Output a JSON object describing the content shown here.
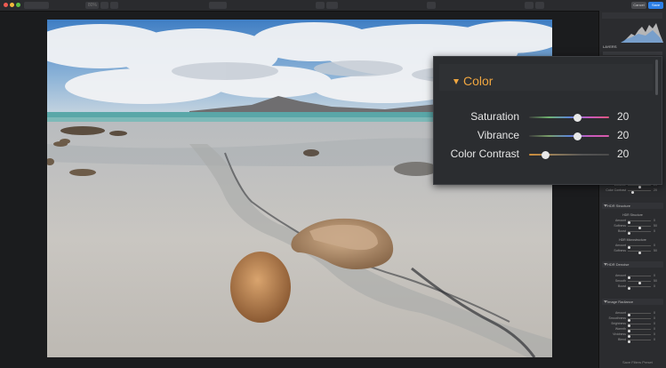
{
  "toolbar": {
    "zoom": "80%",
    "cancel_label": "Cancel",
    "save_label": "Save"
  },
  "side_panel": {
    "layers_label": "LAYERS",
    "visible_items": [
      {
        "label": "Vibrance",
        "value": "20"
      },
      {
        "label": "Color Contrast",
        "value": "20"
      }
    ],
    "sections": [
      {
        "title": "HDR Structure",
        "groups": [
          {
            "title": "HDR Structure",
            "rows": [
              {
                "label": "Amount",
                "value": "0"
              },
              {
                "label": "Softness",
                "value": "50"
              },
              {
                "label": "Boost",
                "value": "0"
              }
            ]
          },
          {
            "title": "HDR Microstructure",
            "rows": [
              {
                "label": "Amount",
                "value": "0"
              },
              {
                "label": "Softness",
                "value": "50"
              }
            ]
          }
        ]
      },
      {
        "title": "HDR Denoise",
        "groups": [
          {
            "title": "",
            "rows": [
              {
                "label": "Amount",
                "value": "0"
              },
              {
                "label": "Smooth",
                "value": "50"
              },
              {
                "label": "Boost",
                "value": "0"
              }
            ]
          }
        ]
      },
      {
        "title": "Image Radiance",
        "groups": [
          {
            "title": "",
            "rows": [
              {
                "label": "Amount",
                "value": "0"
              },
              {
                "label": "Smoothness",
                "value": "0"
              },
              {
                "label": "Brightness",
                "value": "0"
              },
              {
                "label": "Warmth",
                "value": "0"
              },
              {
                "label": "Vividness",
                "value": "0"
              },
              {
                "label": "Blend",
                "value": "0"
              }
            ]
          }
        ]
      }
    ],
    "footer_label": "Save Filters Preset"
  },
  "color_panel": {
    "title": "Color",
    "sliders": [
      {
        "label": "Saturation",
        "value": "20",
        "fraction": 0.6,
        "gradient": "linear-gradient(90deg,#3a3a3a,#6fb36f,#5d86d6,#c85bc0,#e0567e)"
      },
      {
        "label": "Vibrance",
        "value": "20",
        "fraction": 0.6,
        "gradient": "linear-gradient(90deg,#3a3a3a,#7a9f6a,#5d86d6,#c85bc0,#d95aa8)"
      },
      {
        "label": "Color Contrast",
        "value": "20",
        "fraction": 0.2,
        "gradient": "linear-gradient(90deg,#d08f3a,#8f7a5a,#555,#4a4a4a)"
      }
    ]
  },
  "colors": {
    "accent": "#f0a640",
    "save_blue": "#2d7fe6"
  }
}
